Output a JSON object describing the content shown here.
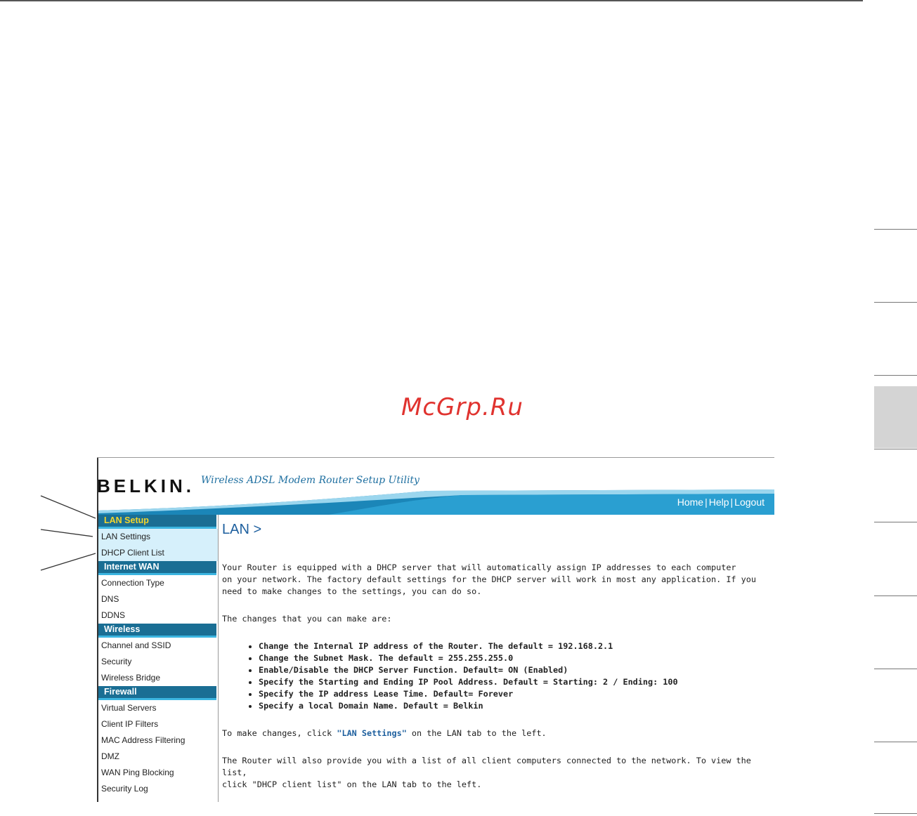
{
  "watermark": "McGrp.Ru",
  "header": {
    "logo": "BELKIN.",
    "tagline": "Wireless ADSL Modem Router Setup Utility",
    "links": [
      "Home",
      "Help",
      "Logout"
    ]
  },
  "sidebar": {
    "sections": [
      {
        "title": "LAN Setup",
        "items": [
          "LAN Settings",
          "DHCP Client List"
        ]
      },
      {
        "title": "Internet WAN",
        "items": [
          "Connection Type",
          "DNS",
          "DDNS"
        ]
      },
      {
        "title": "Wireless",
        "items": [
          "Channel and SSID",
          "Security",
          "Wireless Bridge"
        ]
      },
      {
        "title": "Firewall",
        "items": [
          "Virtual Servers",
          "Client IP Filters",
          "MAC Address Filtering",
          "DMZ",
          "WAN Ping Blocking",
          "Security Log"
        ]
      }
    ]
  },
  "content": {
    "title": "LAN >",
    "intro_1": "Your Router is equipped with a DHCP server that will automatically assign IP addresses to each computer",
    "intro_2": "on your network. The factory default settings for the DHCP server will work in most any application. If you",
    "intro_3": "need to make changes to the settings, you can do so.",
    "changes_heading": "The changes that you can make are:",
    "bullets": [
      "Change the Internal IP address of the Router. The default = 192.168.2.1",
      "Change the Subnet Mask. The default = 255.255.255.0",
      "Enable/Disable the DHCP Server Function. Default= ON (Enabled)",
      "Specify the Starting and Ending IP Pool Address. Default = Starting: 2 / Ending: 100",
      "Specify the IP address Lease Time. Default= Forever",
      "Specify a local Domain Name. Default = Belkin"
    ],
    "make_changes_pre": "To make changes, click ",
    "make_changes_link": "\"LAN Settings\"",
    "make_changes_post": " on the LAN tab to the left.",
    "client_list_1": "The Router will also provide you with a list of all client computers connected to the network. To view the list,",
    "client_list_2": "click \"DHCP client list\" on the LAN tab to the left."
  },
  "colors": {
    "accent": "#1a6e94",
    "active_section": "#f3d62c",
    "highlight": "#d6f0fb",
    "watermark": "#e0332f"
  }
}
